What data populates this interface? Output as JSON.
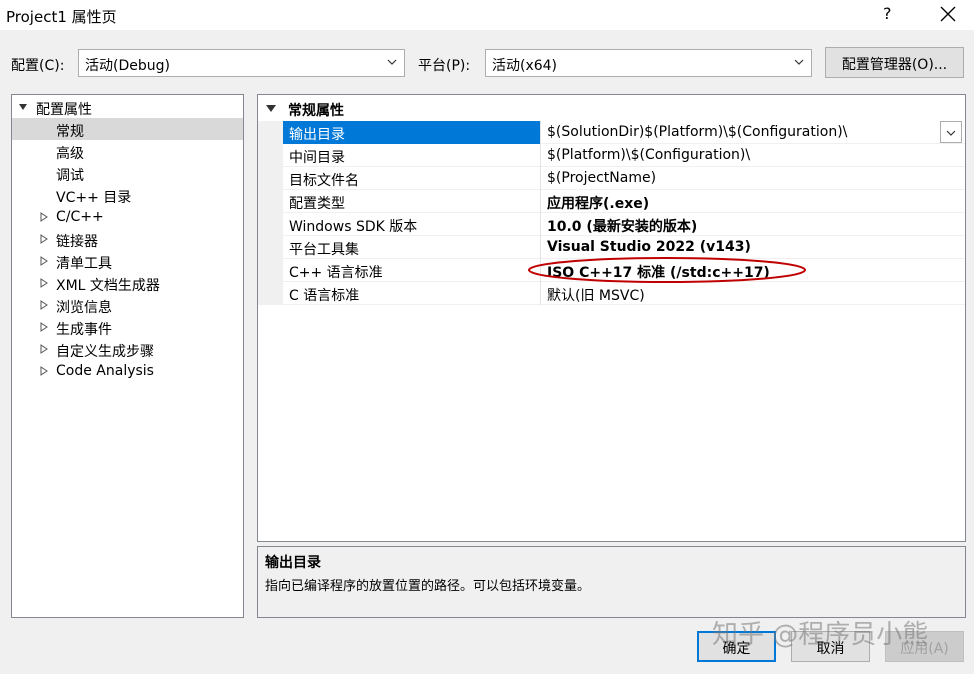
{
  "window": {
    "title": "Project1 属性页",
    "help_label": "?"
  },
  "toolbar": {
    "config_label": "配置(C):",
    "config_value": "活动(Debug)",
    "platform_label": "平台(P):",
    "platform_value": "活动(x64)",
    "config_manager_button": "配置管理器(O)..."
  },
  "tree": {
    "root": "配置属性",
    "items": [
      {
        "label": "常规",
        "selected": true
      },
      {
        "label": "高级"
      },
      {
        "label": "调试"
      },
      {
        "label": "VC++ 目录"
      },
      {
        "label": "C/C++",
        "expandable": true
      },
      {
        "label": "链接器",
        "expandable": true
      },
      {
        "label": "清单工具",
        "expandable": true
      },
      {
        "label": "XML 文档生成器",
        "expandable": true
      },
      {
        "label": "浏览信息",
        "expandable": true
      },
      {
        "label": "生成事件",
        "expandable": true
      },
      {
        "label": "自定义生成步骤",
        "expandable": true
      },
      {
        "label": "Code Analysis",
        "expandable": true
      }
    ]
  },
  "grid": {
    "category": "常规属性",
    "rows": [
      {
        "name": "输出目录",
        "value": "$(SolutionDir)$(Platform)\\$(Configuration)\\",
        "bold": false,
        "selected": true
      },
      {
        "name": "中间目录",
        "value": "$(Platform)\\$(Configuration)\\",
        "bold": false
      },
      {
        "name": "目标文件名",
        "value": "$(ProjectName)",
        "bold": false
      },
      {
        "name": "配置类型",
        "value": "应用程序(.exe)",
        "bold": true
      },
      {
        "name": "Windows SDK 版本",
        "value": "10.0 (最新安装的版本)",
        "bold": true
      },
      {
        "name": "平台工具集",
        "value": "Visual Studio 2022 (v143)",
        "bold": true
      },
      {
        "name": "C++ 语言标准",
        "value": "ISO C++17 标准 (/std:c++17)",
        "bold": true
      },
      {
        "name": "C 语言标准",
        "value": "默认(旧 MSVC)",
        "bold": false
      }
    ]
  },
  "description": {
    "title": "输出目录",
    "text": "指向已编译程序的放置位置的路径。可以包括环境变量。"
  },
  "buttons": {
    "ok": "确定",
    "cancel": "取消",
    "apply": "应用(A)"
  },
  "watermark": "知乎 @程序员小熊",
  "colors": {
    "selection": "#0078d7",
    "annotation": "#c00000",
    "tree_selection": "#d9d9d9"
  }
}
